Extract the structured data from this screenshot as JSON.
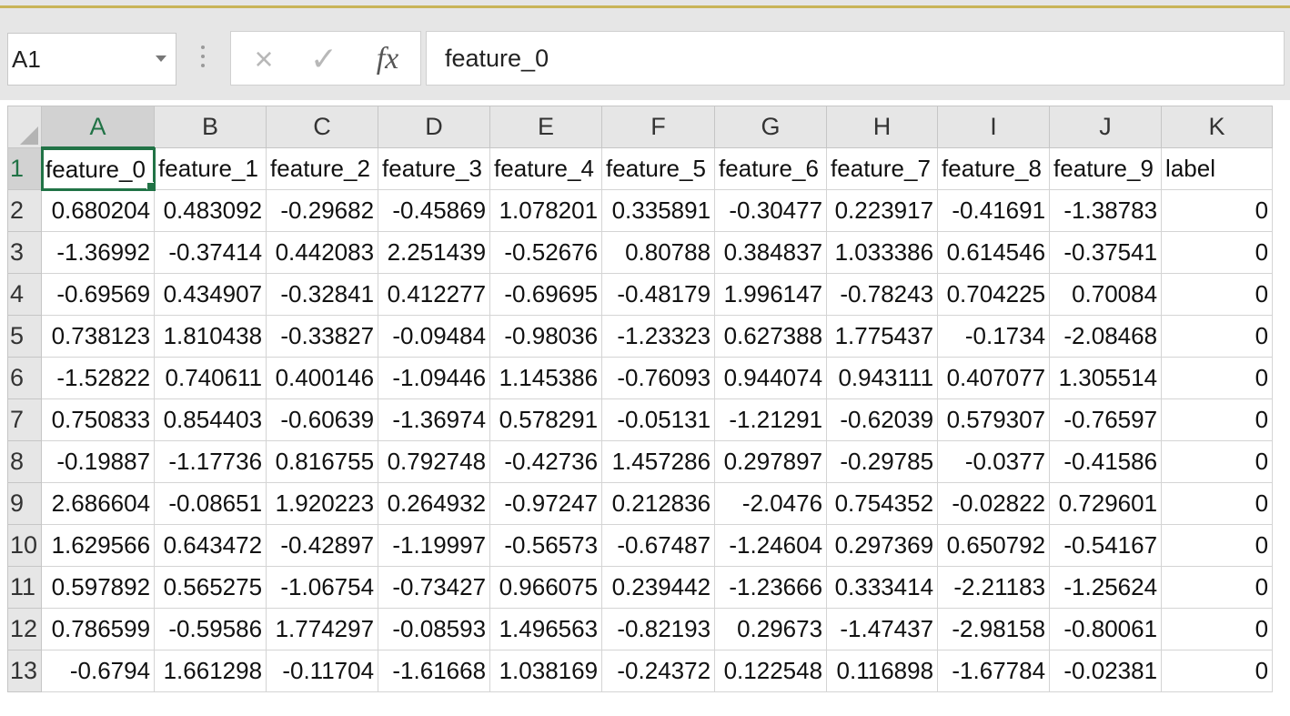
{
  "formula_bar": {
    "name_box": "A1",
    "formula": "feature_0",
    "cancel_icon": "×",
    "enter_icon": "✓",
    "insert_function_icon": "fx"
  },
  "colors": {
    "selection": "#217346",
    "header_bg": "#e6e6e6",
    "accent": "#c9b458"
  },
  "grid": {
    "columns": [
      "A",
      "B",
      "C",
      "D",
      "E",
      "F",
      "G",
      "H",
      "I",
      "J",
      "K"
    ],
    "header_row": {
      "number": "1",
      "cells": [
        "feature_0",
        "feature_1",
        "feature_2",
        "feature_3",
        "feature_4",
        "feature_5",
        "feature_6",
        "feature_7",
        "feature_8",
        "feature_9",
        "label"
      ]
    },
    "rows": [
      {
        "number": "2",
        "cells": [
          "0.680204",
          "0.483092",
          "-0.29682",
          "-0.45869",
          "1.078201",
          "0.335891",
          "-0.30477",
          "0.223917",
          "-0.41691",
          "-1.38783",
          "0"
        ]
      },
      {
        "number": "3",
        "cells": [
          "-1.36992",
          "-0.37414",
          "0.442083",
          "2.251439",
          "-0.52676",
          "0.80788",
          "0.384837",
          "1.033386",
          "0.614546",
          "-0.37541",
          "0"
        ]
      },
      {
        "number": "4",
        "cells": [
          "-0.69569",
          "0.434907",
          "-0.32841",
          "0.412277",
          "-0.69695",
          "-0.48179",
          "1.996147",
          "-0.78243",
          "0.704225",
          "0.70084",
          "0"
        ]
      },
      {
        "number": "5",
        "cells": [
          "0.738123",
          "1.810438",
          "-0.33827",
          "-0.09484",
          "-0.98036",
          "-1.23323",
          "0.627388",
          "1.775437",
          "-0.1734",
          "-2.08468",
          "0"
        ]
      },
      {
        "number": "6",
        "cells": [
          "-1.52822",
          "0.740611",
          "0.400146",
          "-1.09446",
          "1.145386",
          "-0.76093",
          "0.944074",
          "0.943111",
          "0.407077",
          "1.305514",
          "0"
        ]
      },
      {
        "number": "7",
        "cells": [
          "0.750833",
          "0.854403",
          "-0.60639",
          "-1.36974",
          "0.578291",
          "-0.05131",
          "-1.21291",
          "-0.62039",
          "0.579307",
          "-0.76597",
          "0"
        ]
      },
      {
        "number": "8",
        "cells": [
          "-0.19887",
          "-1.17736",
          "0.816755",
          "0.792748",
          "-0.42736",
          "1.457286",
          "0.297897",
          "-0.29785",
          "-0.0377",
          "-0.41586",
          "0"
        ]
      },
      {
        "number": "9",
        "cells": [
          "2.686604",
          "-0.08651",
          "1.920223",
          "0.264932",
          "-0.97247",
          "0.212836",
          "-2.0476",
          "0.754352",
          "-0.02822",
          "0.729601",
          "0"
        ]
      },
      {
        "number": "10",
        "cells": [
          "1.629566",
          "0.643472",
          "-0.42897",
          "-1.19997",
          "-0.56573",
          "-0.67487",
          "-1.24604",
          "0.297369",
          "0.650792",
          "-0.54167",
          "0"
        ]
      },
      {
        "number": "11",
        "cells": [
          "0.597892",
          "0.565275",
          "-1.06754",
          "-0.73427",
          "0.966075",
          "0.239442",
          "-1.23666",
          "0.333414",
          "-2.21183",
          "-1.25624",
          "0"
        ]
      },
      {
        "number": "12",
        "cells": [
          "0.786599",
          "-0.59586",
          "1.774297",
          "-0.08593",
          "1.496563",
          "-0.82193",
          "0.29673",
          "-1.47437",
          "-2.98158",
          "-0.80061",
          "0"
        ]
      },
      {
        "number": "13",
        "cells": [
          "-0.6794",
          "1.661298",
          "-0.11704",
          "-1.61668",
          "1.038169",
          "-0.24372",
          "0.122548",
          "0.116898",
          "-1.67784",
          "-0.02381",
          "0"
        ]
      }
    ]
  }
}
